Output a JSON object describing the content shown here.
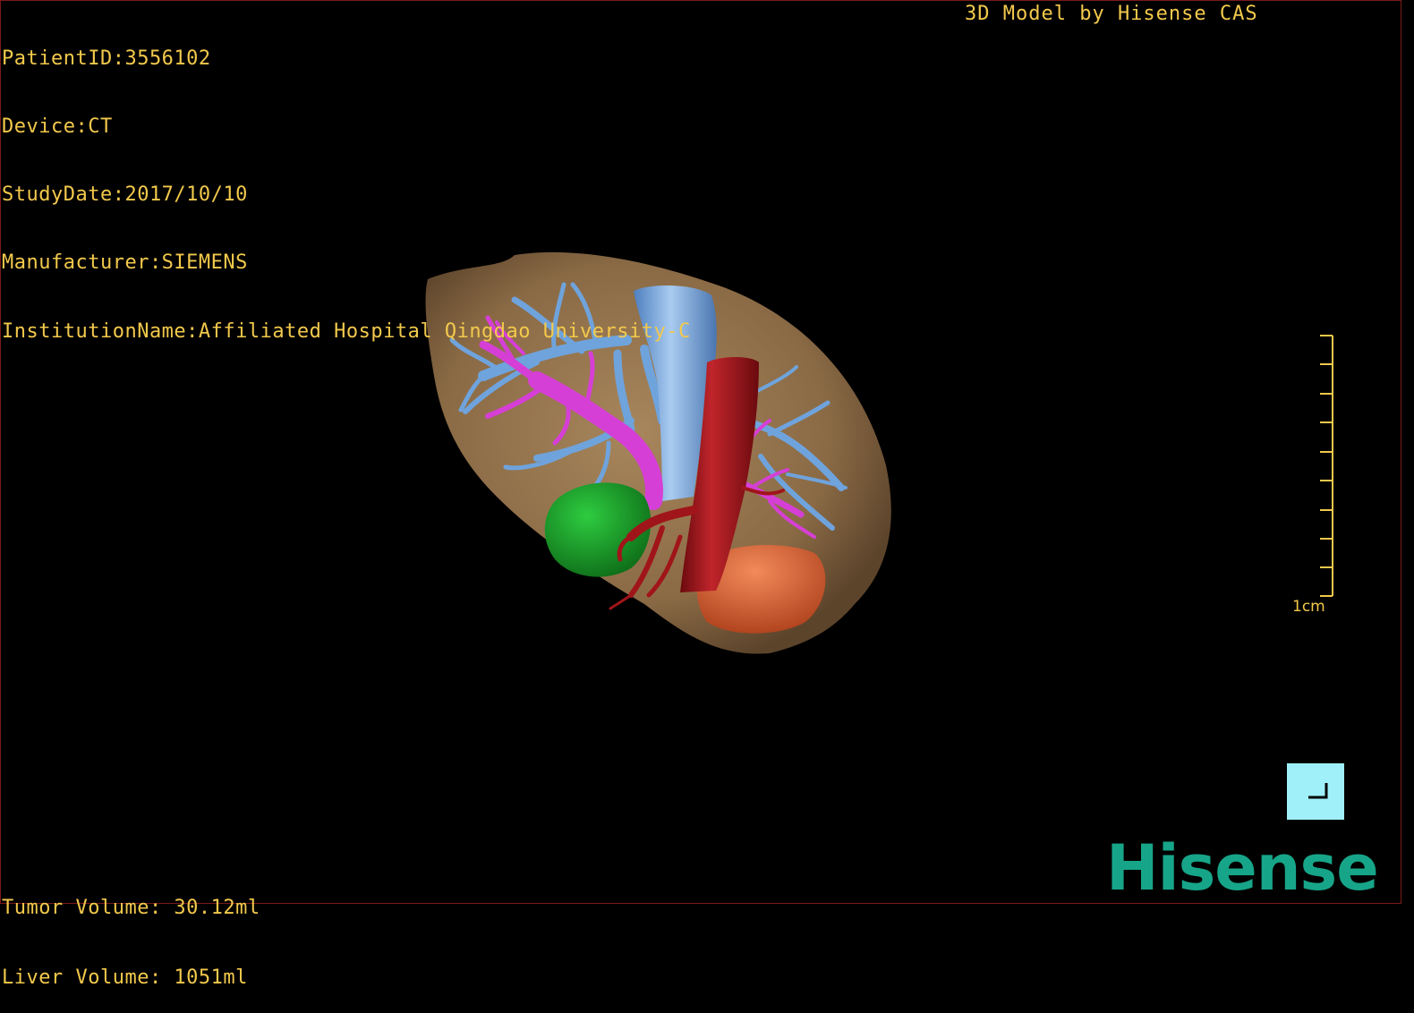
{
  "header": {
    "patient_id": "PatientID:3556102",
    "device": "Device:CT",
    "study_date": "StudyDate:2017/10/10",
    "manufacturer": "Manufacturer:SIEMENS",
    "institution": "InstitutionName:Affiliated Hospital Qingdao University-C"
  },
  "credit": "3D Model by Hisense CAS",
  "volumes": {
    "tumor": "Tumor Volume: 30.12ml",
    "liver": "Liver Volume: 1051ml"
  },
  "scale": {
    "label": "1cm"
  },
  "brand": {
    "logo_text": "Hisense"
  },
  "colors": {
    "overlay_text": "#f2c94c",
    "liver": "#8a6a45",
    "hepatic_vein": "#6fa3dc",
    "portal_vein": "#d63fd6",
    "artery": "#a0151a",
    "tumor_green": "#1aa32a",
    "tumor_orange": "#e06a3a",
    "reset_button": "#9ff0f8",
    "logo": "#17a589"
  },
  "icons": {
    "reset": "corner-reset-icon"
  }
}
